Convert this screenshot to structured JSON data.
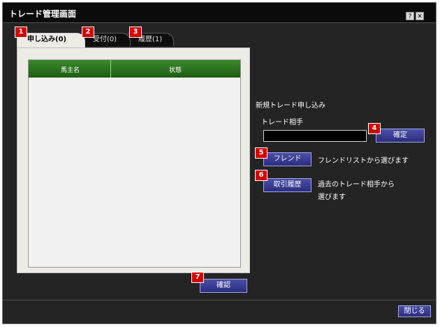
{
  "window": {
    "title": "トレード管理画面",
    "help_glyph": "?",
    "close_glyph": "✕"
  },
  "tabs": [
    {
      "label": "申し込み(0)",
      "badge": "1"
    },
    {
      "label": "受付(0)",
      "badge": "2"
    },
    {
      "label": "履歴(1)",
      "badge": "3"
    }
  ],
  "table": {
    "columns": [
      "馬主名",
      "状態"
    ],
    "rows": []
  },
  "new_trade": {
    "heading": "新規トレード申し込み",
    "partner_label": "トレード相手",
    "partner_value": "",
    "confirm_label": "確定",
    "confirm_badge": "4",
    "friend_button": "フレンド",
    "friend_badge": "5",
    "friend_desc": "フレンドリストから選びます",
    "history_button": "取引履歴",
    "history_badge": "6",
    "history_desc_1": "過去のトレード相手から",
    "history_desc_2": "選びます"
  },
  "footer": {
    "check_button": "確認",
    "check_badge": "7",
    "close_button": "閉じる"
  },
  "colors": {
    "window_bg": "#242424",
    "header_green": "#2b7420",
    "button_blue": "#3a3e96",
    "badge_red": "#d40000"
  }
}
